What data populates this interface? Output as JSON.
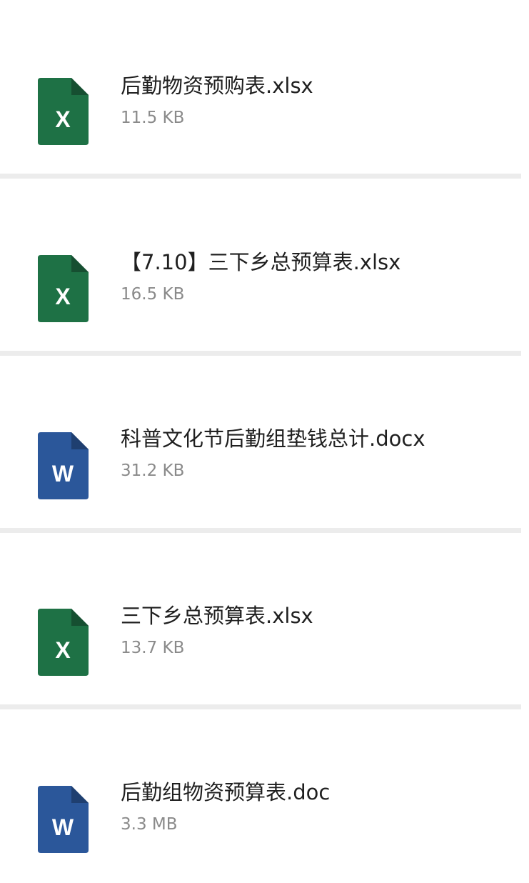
{
  "files": [
    {
      "name": "后勤物资预购表.xlsx",
      "size": "11.5 KB",
      "type": "excel",
      "icon": "excel-file-icon",
      "letter": "X",
      "color": "#1e7145"
    },
    {
      "name": "【7.10】三下乡总预算表.xlsx",
      "size": "16.5 KB",
      "type": "excel",
      "icon": "excel-file-icon",
      "letter": "X",
      "color": "#1e7145"
    },
    {
      "name": "科普文化节后勤组垫钱总计.docx",
      "size": "31.2 KB",
      "type": "word",
      "icon": "word-file-icon",
      "letter": "W",
      "color": "#2b579a"
    },
    {
      "name": "三下乡总预算表.xlsx",
      "size": "13.7 KB",
      "type": "excel",
      "icon": "excel-file-icon",
      "letter": "X",
      "color": "#1e7145"
    },
    {
      "name": "后勤组物资预算表.doc",
      "size": "3.3 MB",
      "type": "word",
      "icon": "word-file-icon",
      "letter": "W",
      "color": "#2b579a"
    }
  ]
}
